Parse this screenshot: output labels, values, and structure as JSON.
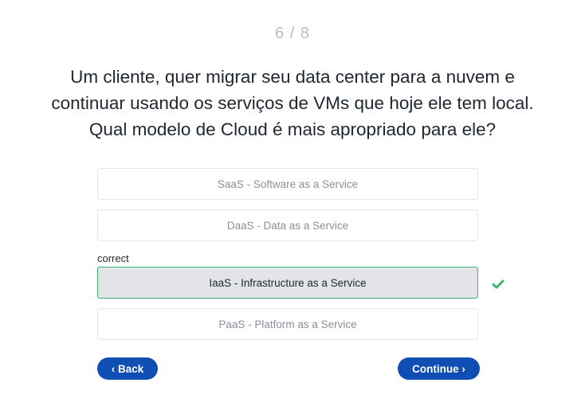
{
  "progress": "6 / 8",
  "question": "Um cliente, quer migrar seu data center para a nuvem e continuar usando os serviços de VMs que hoje ele tem local. Qual modelo de Cloud é mais apropriado para ele?",
  "options": [
    {
      "label": "SaaS - Software as a Service"
    },
    {
      "label": "DaaS - Data as a Service"
    },
    {
      "label": "IaaS - Infrastructure as a Service",
      "selected": true,
      "status": "correct"
    },
    {
      "label": "PaaS - Platform as a Service"
    }
  ],
  "feedback": {
    "correct_label": "correct",
    "icon": "check-icon",
    "color": "#34b86a"
  },
  "nav": {
    "back_label": "‹ Back",
    "continue_label": "Continue ›"
  },
  "colors": {
    "accent": "#0f4fb4",
    "correct": "#34b86a"
  }
}
